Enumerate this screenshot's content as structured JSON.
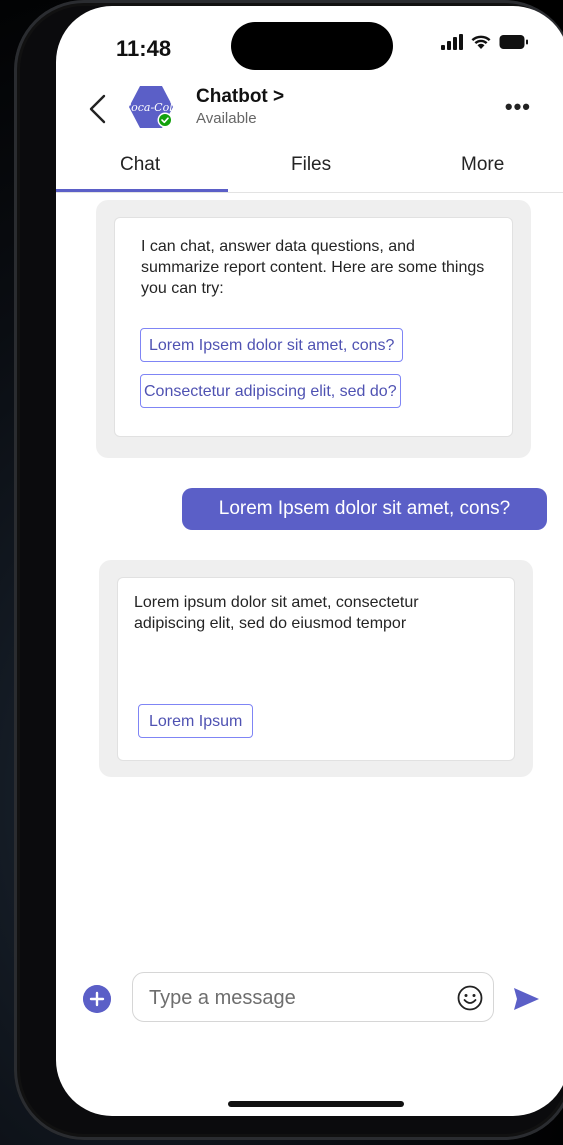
{
  "status_bar": {
    "time": "11:48"
  },
  "header": {
    "title": "Chatbot >",
    "subtitle": "Available",
    "more_label": "•••",
    "avatar_brand_text": "Coca-Cola"
  },
  "tabs": [
    {
      "label": "Chat",
      "active": true
    },
    {
      "label": "Files",
      "active": false
    },
    {
      "label": "More",
      "active": false
    }
  ],
  "messages": {
    "bot_intro": {
      "text": "I can chat, answer data questions, and summarize report content. Here are some things you can try:",
      "suggestions": [
        "Lorem Ipsem dolor sit amet, cons?",
        "Consectetur adipiscing elit, sed do?"
      ]
    },
    "user_message": "Lorem Ipsem dolor sit amet, cons?",
    "bot_reply": {
      "text": "Lorem ipsum dolor sit amet, consectetur adipiscing elit, sed do eiusmod tempor",
      "button": "Lorem Ipsum"
    }
  },
  "compose": {
    "placeholder": "Type a message",
    "icons": [
      "add-icon",
      "emoji-icon",
      "send-icon"
    ]
  },
  "colors": {
    "accent": "#5b5fc7",
    "presence": "#13a10e",
    "avatar_bg": "#5b5fc7"
  }
}
